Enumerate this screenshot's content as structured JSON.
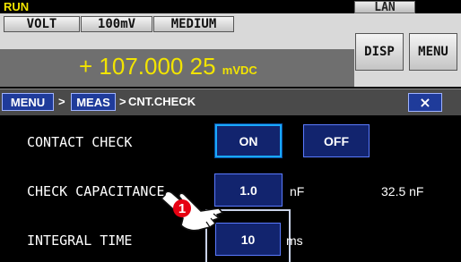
{
  "status": {
    "mode": "RUN",
    "lan_label": "LAN"
  },
  "header": {
    "function": "VOLT",
    "range": "100mV",
    "speed": "MEDIUM",
    "disp_label": "DISP",
    "menu_label": "MENU"
  },
  "measurement": {
    "value": "+ 107.000 25",
    "unit": "mVDC"
  },
  "breadcrumb": {
    "items": [
      "MENU",
      "MEAS"
    ],
    "current": "CNT.CHECK",
    "separator": ">",
    "close_symbol": "×"
  },
  "settings": {
    "contact_check": {
      "label": "CONTACT CHECK",
      "options": [
        "ON",
        "OFF"
      ],
      "selected": "ON"
    },
    "check_capacitance": {
      "label": "CHECK CAPACITANCE",
      "value": "1.0",
      "unit": "nF",
      "measured": "32.5 nF"
    },
    "integral_time": {
      "label": "INTEGRAL TIME",
      "value": "10",
      "unit": "ms"
    }
  },
  "callout": {
    "number": "1"
  }
}
